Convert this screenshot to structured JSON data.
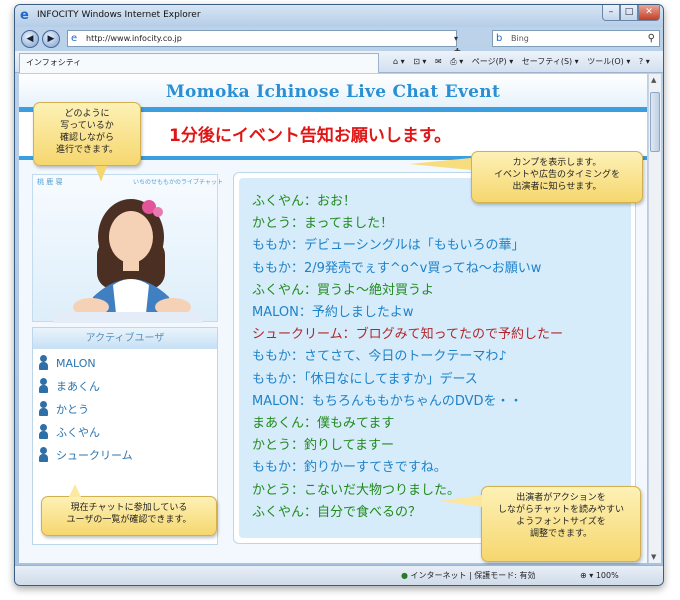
{
  "window": {
    "title": "INFOCITY Windows Internet Explorer",
    "min": "–",
    "max": "□",
    "close": "✕"
  },
  "toolbar": {
    "back": "◀",
    "forward": "▶",
    "address": "http://www.infocity.co.jp",
    "addr_btns": "▾ ✚ ✕",
    "search_placeholder": "Bing",
    "search_btn": "⚲",
    "tab": "インフォシティ",
    "cmds": [
      "⌂ ▾",
      "⊡ ▾",
      "✉",
      "⎙ ▾",
      "ページ(P) ▾",
      "セーフティ(S) ▾",
      "ツール(O) ▾",
      "? ▾"
    ]
  },
  "status": {
    "zone": "インターネット | 保護モード: 有効",
    "zoom": "100%"
  },
  "page": {
    "title": "Momoka Ichinose Live Chat Event",
    "notice": "1分後にイベント告知お願いします。",
    "profile_name": "桃  鹿  寝",
    "profile_sub": "いちのせももかのライブチャット",
    "active_header": "アクティブユーザ",
    "users": [
      "MALON",
      "まあくん",
      "かとう",
      "ふくやん",
      "シュークリーム"
    ]
  },
  "chat": [
    {
      "text": "ふくやん：おお！",
      "color": "#228a1c"
    },
    {
      "text": "かとう：まってました！",
      "color": "#228a1c"
    },
    {
      "text": "ももか：デビューシングルは「ももいろの華」",
      "color": "#1f82c8"
    },
    {
      "text": "ももか：2/9発売でぇす^o^v買ってね〜お願いw",
      "color": "#1f82c8"
    },
    {
      "text": "ふくやん：買うよ〜絶対買うよ",
      "color": "#228a1c"
    },
    {
      "text": "MALON：予約しましたよw",
      "color": "#1f82c8"
    },
    {
      "text": "シュークリーム：ブログみて知ってたので予約したー",
      "color": "#b3262b"
    },
    {
      "text": "ももか：さてさて、今日のトークテーマわ♪",
      "color": "#1f82c8"
    },
    {
      "text": "ももか：「休日なにしてますか」デース",
      "color": "#1f82c8"
    },
    {
      "text": "MALON：もちろんももかちゃんのDVDを・・",
      "color": "#1f82c8"
    },
    {
      "text": "まあくん：僕もみてます",
      "color": "#228a1c"
    },
    {
      "text": "かとう：釣りしてますー",
      "color": "#228a1c"
    },
    {
      "text": "ももか：釣りかーすてきですね。",
      "color": "#1f82c8"
    },
    {
      "text": "かとう：こないだ大物つりました。",
      "color": "#228a1c"
    },
    {
      "text": "ふくやん：自分で食べるの？",
      "color": "#228a1c"
    }
  ],
  "callouts": {
    "top_left": [
      "どのように",
      "写っているか",
      "確認しながら",
      "進行できます。"
    ],
    "top_right": [
      "カンプを表示します。",
      "イベントや広告のタイミングを",
      "出演者に知らせます。"
    ],
    "bottom_left": [
      "現在チャットに参加している",
      "ユーザの一覧が確認できます。"
    ],
    "bottom_right": [
      "出演者がアクションを",
      "しながらチャットを読みやすい",
      "ようフォントサイズを",
      "調整できます。"
    ]
  }
}
